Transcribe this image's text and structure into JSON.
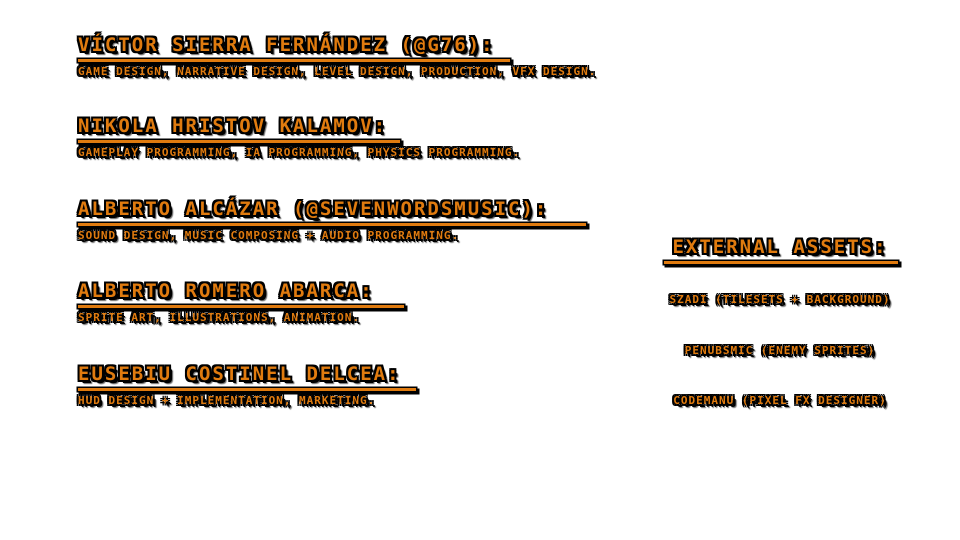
{
  "credits": [
    {
      "name": "Víctor Sierra Fernández (@G76):",
      "role": "Game design, narrative design, level design, production, VFX design."
    },
    {
      "name": "Nikola Hristov Kalamov:",
      "role": "Gameplay programming, IA programming, physics programming."
    },
    {
      "name": "Alberto Alcázar (@SevenWordsMusic):",
      "role": "Sound design, music composing + audio programming."
    },
    {
      "name": "Alberto Romero Abarca:",
      "role": "Sprite art, illustrations, animation."
    },
    {
      "name": "Eusebiu Costinel Delcea:",
      "role": "HUD design + implementation, marketing."
    }
  ],
  "external": {
    "heading": "External assets:",
    "items": [
      "Szadi (tilesets + background)",
      "PenubSmic (enemy sprites)",
      "CodeManu (Pixel FX Designer)"
    ]
  },
  "colors": {
    "text": "#e07b0f",
    "outline": "#000000",
    "background": "#ffffff"
  }
}
